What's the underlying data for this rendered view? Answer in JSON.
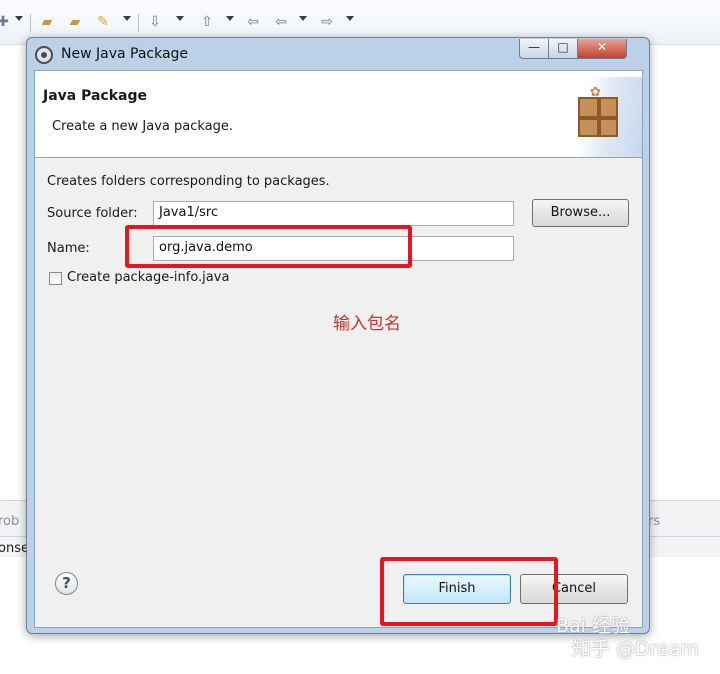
{
  "dialog": {
    "window_title": "New Java Package",
    "header_title": "Java Package",
    "header_description": "Create a new Java package.",
    "intro_text": "Creates folders corresponding to packages.",
    "source_folder_label": "Source folder:",
    "source_folder_value": "Java1/src",
    "browse_label": "Browse...",
    "name_label": "Name:",
    "name_value": "org.java.demo",
    "checkbox_label": "Create package-info.java",
    "checkbox_checked": false,
    "help_label": "?",
    "finish_label": "Finish",
    "cancel_label": "Cancel"
  },
  "window_controls": {
    "minimize": "—",
    "maximize": "□",
    "close": "✕"
  },
  "annotation": {
    "text": "输入包名",
    "color": "#e5161c"
  },
  "background": {
    "toolbar_icons": [
      "new-project-icon",
      "open-folder-icon",
      "open-file-icon",
      "run-icon",
      "next-annotation-icon",
      "prev-annotation-icon",
      "last-edit-icon",
      "back-icon",
      "forward-icon"
    ],
    "panel_tab_left": "rob",
    "panel_tab_right": "rs",
    "panel_row_text": "onse"
  },
  "watermark": {
    "baidu": "Bai 经验",
    "zhihu": "知乎 @Dream"
  }
}
